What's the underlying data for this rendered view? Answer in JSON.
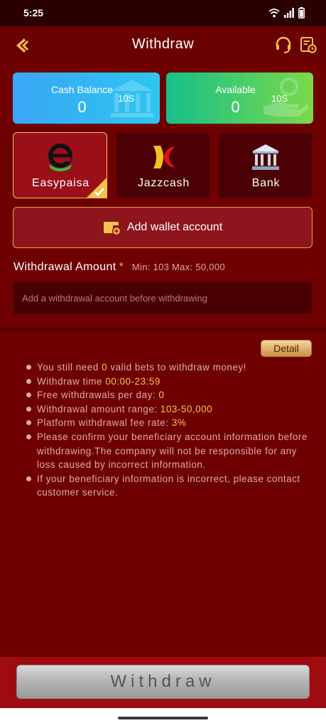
{
  "status_bar": {
    "time": "5:25"
  },
  "header": {
    "title": "Withdraw"
  },
  "balances": {
    "cash": {
      "label": "Cash Balance",
      "value": "0",
      "badge": "10S"
    },
    "available": {
      "label": "Available",
      "value": "0",
      "badge": "10S"
    }
  },
  "methods": [
    {
      "label": "Easypaisa",
      "selected": true
    },
    {
      "label": "Jazzcash",
      "selected": false
    },
    {
      "label": "Bank",
      "selected": false
    }
  ],
  "add_wallet": {
    "label": "Add wallet account"
  },
  "amount": {
    "label": "Withdrawal Amount",
    "required_mark": "*",
    "range": "Min: 103 Max: 50,000",
    "placeholder": "Add a withdrawal account before withdrawing"
  },
  "info": {
    "detail_label": "Detail",
    "items": [
      {
        "pre": "You still need ",
        "hl": "0",
        "post": " valid bets to withdraw money!"
      },
      {
        "pre": "Withdraw time ",
        "hl": "00:00-23:59",
        "post": ""
      },
      {
        "pre": "Free withdrawals per day: ",
        "hl": "0",
        "post": ""
      },
      {
        "pre": "Withdrawal amount range: ",
        "hl": "103-50,000",
        "post": ""
      },
      {
        "pre": "Platform withdrawal fee rate: ",
        "hl": "3%",
        "post": ""
      },
      {
        "pre": "Please confirm your beneficiary account information before withdrawing.The company will not be responsible for any loss caused by incorrect information.",
        "hl": "",
        "post": ""
      },
      {
        "pre": "If your beneficiary information is incorrect, please contact customer service.",
        "hl": "",
        "post": ""
      }
    ]
  },
  "withdraw_button": {
    "label": "Withdraw"
  },
  "colors": {
    "background": "#6e0000",
    "accent_gold": "#f6c24c",
    "cash_card": "#2cb2f2",
    "available_card": "#2cca6e"
  },
  "icons": {
    "back": "back-arrow-icon",
    "support": "headset-icon",
    "record": "withdraw-record-icon",
    "easypaisa": "easypaisa-logo",
    "jazzcash": "jazzcash-logo",
    "bank": "bank-building-icon",
    "wallet": "wallet-add-icon"
  }
}
